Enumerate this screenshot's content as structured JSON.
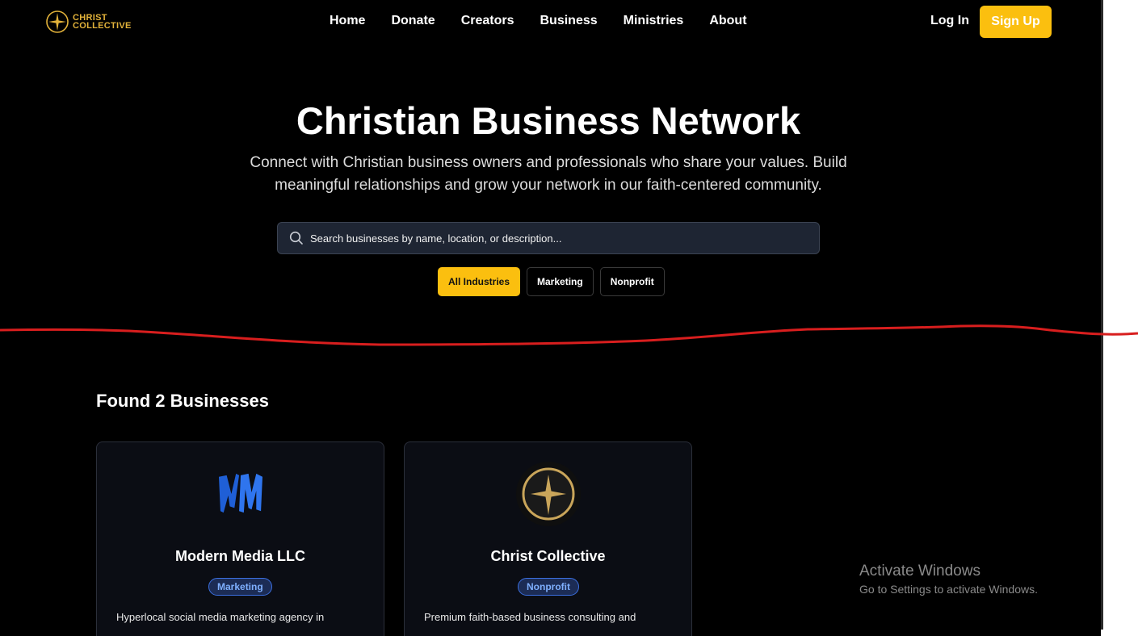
{
  "nav": {
    "logo_line1": "CHRIST",
    "logo_line2": "COLLECTIVE",
    "links": [
      "Home",
      "Donate",
      "Creators",
      "Business",
      "Ministries",
      "About"
    ],
    "login": "Log In",
    "signup": "Sign Up"
  },
  "hero": {
    "title": "Christian Business Network",
    "subtitle_line1": "Connect with Christian business owners and professionals who share your values. Build",
    "subtitle_line2": "meaningful relationships and grow your network in our faith-centered community.",
    "search_placeholder": "Search businesses by name, location, or description...",
    "filters": [
      "All Industries",
      "Marketing",
      "Nonprofit"
    ],
    "active_filter": "All Industries"
  },
  "results": {
    "heading": "Found 2 Businesses",
    "cards": [
      {
        "name": "Modern Media LLC",
        "category": "Marketing",
        "description": "Hyperlocal social media marketing agency in",
        "logo_icon": "mm-logo-icon"
      },
      {
        "name": "Christ Collective",
        "category": "Nonprofit",
        "description": "Premium faith-based business consulting and",
        "logo_icon": "star-cross-logo-icon"
      }
    ]
  },
  "watermark": {
    "title": "Activate Windows",
    "subtitle": "Go to Settings to activate Windows."
  },
  "colors": {
    "accent": "#fbbf0f",
    "background": "#000000",
    "card_bg": "#0b0d14",
    "badge_border": "#3b6fe0",
    "annotation_red": "#d81e1e"
  }
}
